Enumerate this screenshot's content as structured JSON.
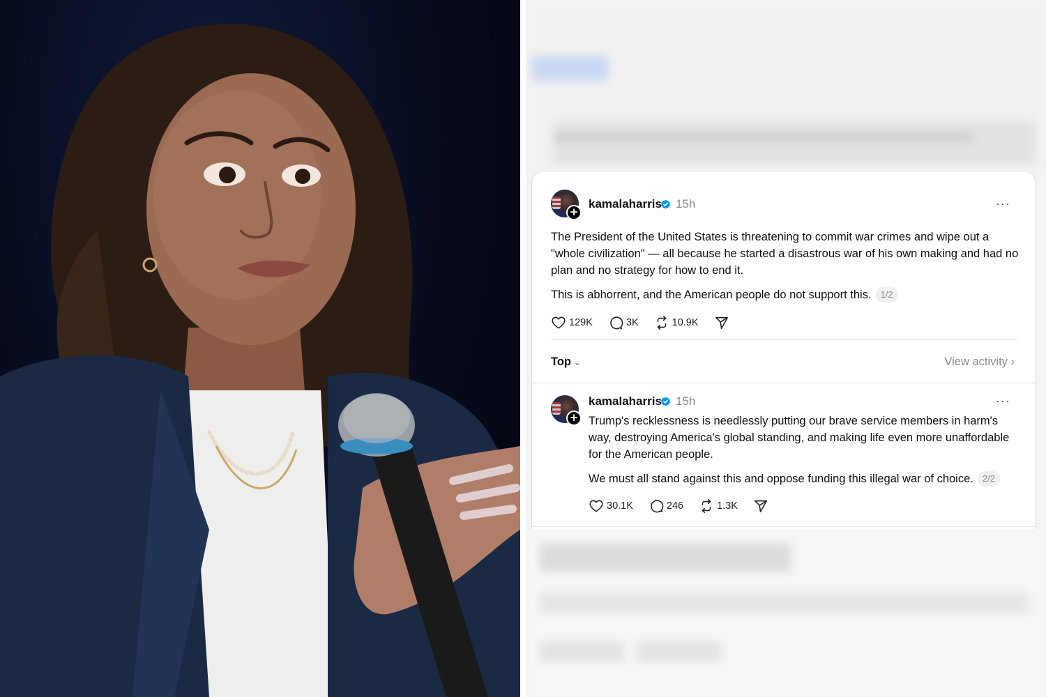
{
  "photo": {
    "subject": "speaker-with-microphone",
    "background_color": "#070b1c",
    "jacket_color": "#1a2a44"
  },
  "thread": {
    "posts": [
      {
        "username": "kamalaharris",
        "verified": true,
        "time": "15h",
        "paragraphs": [
          "The President of the United States is threatening to commit war crimes and wipe out a \"whole civilization\" — all because he started a disastrous war of his own making and had no plan and no strategy for how to end it.",
          "This is abhorrent, and the American people do not support this."
        ],
        "page_indicator": "1/2",
        "likes": "129K",
        "replies": "3K",
        "reposts": "10.9K"
      },
      {
        "username": "kamalaharris",
        "verified": true,
        "time": "15h",
        "paragraphs": [
          "Trump's recklessness is needlessly putting our brave service members in harm's way, destroying America's global standing, and making life even more unaffordable for the American people.",
          "We must all stand against this and oppose funding this illegal war of choice."
        ],
        "page_indicator": "2/2",
        "likes": "30.1K",
        "replies": "246",
        "reposts": "1.3K"
      }
    ],
    "sort_label": "Top",
    "view_activity_label": "View activity",
    "more_glyph": "···",
    "verified_color": "#0095f6"
  }
}
